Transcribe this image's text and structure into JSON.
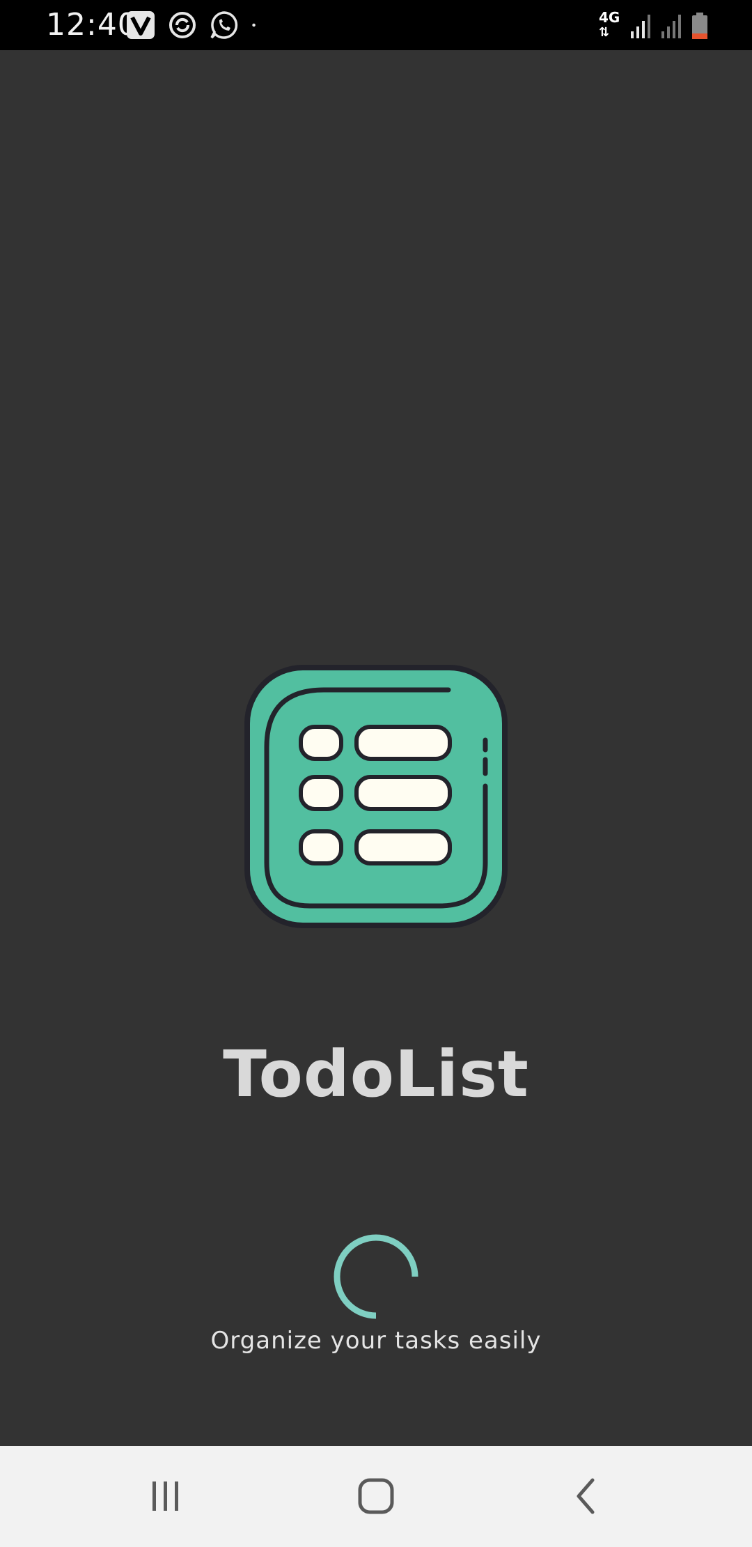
{
  "status_bar": {
    "time": "12:40",
    "network_type": "4G",
    "network_arrows": "⇅",
    "icons": [
      "v-app-icon",
      "sync-icon",
      "whatsapp-icon",
      "notification-dot-icon"
    ],
    "signal_icons": [
      "signal-1-icon",
      "signal-2-icon"
    ],
    "battery_icon": "battery-low-icon"
  },
  "splash": {
    "app_name": "TodoList",
    "tagline": "Organize your tasks easily",
    "logo_icon": "todo-list-logo-icon"
  },
  "colors": {
    "background": "#333333",
    "logo_green": "#52BFA0",
    "logo_outline": "#23232b",
    "logo_rows": "#FFFDF2",
    "spinner": "#7FCFC2",
    "title": "#D9D9D9",
    "nav_bar": "#F2F2F2",
    "battery_low": "#E5532E"
  },
  "navigation": {
    "buttons": [
      "recent-apps-icon",
      "home-icon",
      "back-icon"
    ]
  }
}
